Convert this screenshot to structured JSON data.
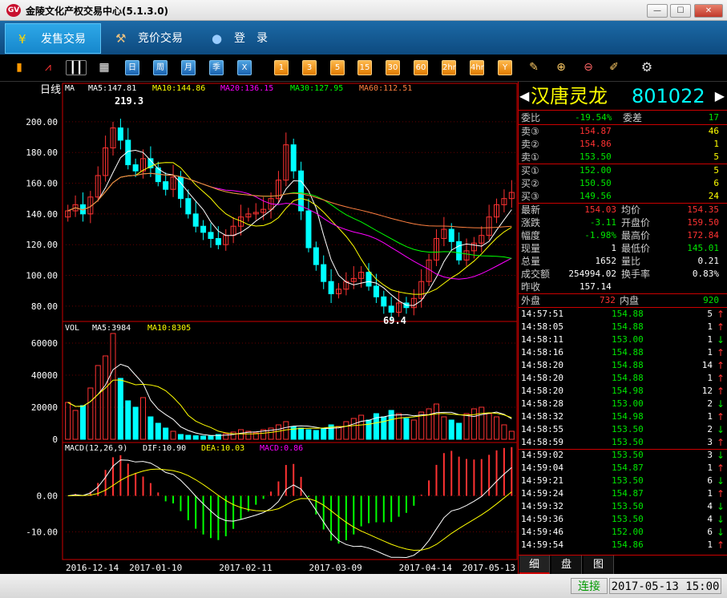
{
  "window": {
    "title": "金陵文化产权交易中心(5.1.3.0)",
    "icon_text": "GV",
    "controls": [
      "minimize-icon",
      "maximize-icon",
      "close-icon"
    ]
  },
  "menu": {
    "tabs": [
      {
        "label": "发售交易",
        "icon": "yen-icon",
        "active": true
      },
      {
        "label": "竞价交易",
        "icon": "gavel-icon",
        "active": false
      },
      {
        "label": "登　录",
        "icon": "user-icon",
        "active": false
      }
    ]
  },
  "toolbar": {
    "icons": [
      "bar-chart-icon",
      "line-chart-icon",
      "candle-chart-icon",
      "calendar-icon"
    ],
    "period_buttons": [
      "日",
      "周",
      "月",
      "季",
      "X"
    ],
    "minute_buttons": [
      "1",
      "3",
      "5",
      "15",
      "30",
      "60",
      "2hr",
      "4hr",
      "Y"
    ],
    "tool_icons": [
      "edit-icon",
      "zoom-in-icon",
      "zoom-out-icon",
      "draw-icon",
      "gear-icon"
    ]
  },
  "chart_data": {
    "type": "candlestick",
    "period_label": "日线",
    "series_label": "MA",
    "ma": {
      "MA5": "147.81",
      "MA10": "144.86",
      "MA20": "136.15",
      "MA30": "127.95",
      "MA60": "112.51"
    },
    "colors": {
      "MA5": "#ffffff",
      "MA10": "#ffff00",
      "MA20": "#ff00ff",
      "MA30": "#00ff00",
      "MA60": "#ff8040",
      "up": "#ff3232",
      "down": "#00ffff"
    },
    "price_ticks": [
      "200.00",
      "180.00",
      "160.00",
      "140.00",
      "120.00",
      "100.00",
      "80.00"
    ],
    "ylim": [
      70,
      225
    ],
    "high_mark": "219.3",
    "low_mark": "69.4",
    "close": [
      142,
      146,
      140,
      151,
      165,
      183,
      196,
      188,
      172,
      168,
      176,
      170,
      161,
      156,
      164,
      150,
      140,
      132,
      128,
      124,
      120,
      126,
      132,
      138,
      140,
      141,
      143,
      150,
      162,
      185,
      168,
      142,
      118,
      107,
      96,
      88,
      91,
      96,
      98,
      102,
      93,
      86,
      80,
      76,
      82,
      79,
      85,
      96,
      110,
      124,
      130,
      122,
      110,
      116,
      121,
      126,
      138,
      146,
      150,
      154
    ],
    "volume": {
      "label": "VOL",
      "MA5": "3984",
      "MA10": "8305",
      "ticks": [
        "60000",
        "40000",
        "20000",
        "0"
      ],
      "ylim": [
        0,
        70000
      ],
      "values": [
        23000,
        18000,
        21000,
        32000,
        46000,
        52000,
        66000,
        38000,
        24000,
        20000,
        26000,
        14000,
        10000,
        7000,
        5000,
        3000,
        2500,
        2200,
        2000,
        2000,
        3000,
        3500,
        4500,
        6000,
        5000,
        4000,
        6000,
        7000,
        9000,
        11000,
        8000,
        7000,
        6000,
        5500,
        7000,
        9000,
        8000,
        11000,
        13000,
        15000,
        12000,
        16000,
        14000,
        18000,
        16000,
        13000,
        12000,
        17000,
        19000,
        22000,
        14000,
        12000,
        10000,
        16000,
        19000,
        20000,
        16000,
        14000,
        9000,
        5000
      ]
    },
    "macd": {
      "label": "MACD(12,26,9)",
      "DIF": "10.90",
      "DEA": "10.03",
      "MACD": "0.86",
      "ticks": [
        "0.00",
        "-10.00"
      ],
      "ylim": [
        -17,
        13
      ]
    },
    "x_dates": [
      "2016-12-14",
      "2017-01-10",
      "2017-02-11",
      "2017-03-09",
      "2017-04-14",
      "2017-05-13"
    ]
  },
  "stock": {
    "name": "汉唐灵龙",
    "code": "801022"
  },
  "quote": {
    "weibi_label": "委比",
    "weibi": "-19.54%",
    "weicha_label": "委差",
    "weicha": "17",
    "asks": [
      {
        "label": "卖③",
        "price": "154.87",
        "vol": "46"
      },
      {
        "label": "卖②",
        "price": "154.86",
        "vol": "1"
      },
      {
        "label": "卖①",
        "price": "153.50",
        "vol": "5"
      }
    ],
    "bids": [
      {
        "label": "买①",
        "price": "152.00",
        "vol": "5"
      },
      {
        "label": "买②",
        "price": "150.50",
        "vol": "6"
      },
      {
        "label": "买③",
        "price": "149.56",
        "vol": "24"
      }
    ],
    "stats": [
      {
        "l1": "最新",
        "v1": "154.03",
        "c1": "red",
        "l2": "均价",
        "v2": "154.35",
        "c2": "red"
      },
      {
        "l1": "涨跌",
        "v1": "-3.11",
        "c1": "green",
        "l2": "开盘价",
        "v2": "159.50",
        "c2": "red"
      },
      {
        "l1": "幅度",
        "v1": "-1.98%",
        "c1": "green",
        "l2": "最高价",
        "v2": "172.84",
        "c2": "red"
      },
      {
        "l1": "现量",
        "v1": "1",
        "c1": "white",
        "l2": "最低价",
        "v2": "145.01",
        "c2": "green"
      },
      {
        "l1": "总量",
        "v1": "1652",
        "c1": "white",
        "l2": "量比",
        "v2": "0.21",
        "c2": "white"
      },
      {
        "l1": "成交额",
        "v1": "254994.02",
        "c1": "white",
        "l2": "换手率",
        "v2": "0.83%",
        "c2": "white"
      }
    ],
    "prev_close_label": "昨收",
    "prev_close": "157.14",
    "outer_label": "外盘",
    "outer": "732",
    "inner_label": "内盘",
    "inner": "920"
  },
  "trades": [
    {
      "t": "14:57:51",
      "p": "154.88",
      "v": "5",
      "d": "up"
    },
    {
      "t": "14:58:05",
      "p": "154.88",
      "v": "1",
      "d": "up"
    },
    {
      "t": "14:58:11",
      "p": "153.00",
      "v": "1",
      "d": "down"
    },
    {
      "t": "14:58:16",
      "p": "154.88",
      "v": "1",
      "d": "up"
    },
    {
      "t": "14:58:20",
      "p": "154.88",
      "v": "14",
      "d": "up"
    },
    {
      "t": "14:58:20",
      "p": "154.88",
      "v": "1",
      "d": "up"
    },
    {
      "t": "14:58:20",
      "p": "154.98",
      "v": "12",
      "d": "up"
    },
    {
      "t": "14:58:28",
      "p": "153.00",
      "v": "2",
      "d": "down"
    },
    {
      "t": "14:58:32",
      "p": "154.98",
      "v": "1",
      "d": "up"
    },
    {
      "t": "14:58:55",
      "p": "153.50",
      "v": "2",
      "d": "down"
    },
    {
      "t": "14:58:59",
      "p": "153.50",
      "v": "3",
      "d": "up"
    },
    {
      "t": "14:59:02",
      "p": "153.50",
      "v": "3",
      "d": "down"
    },
    {
      "t": "14:59:04",
      "p": "154.87",
      "v": "1",
      "d": "up"
    },
    {
      "t": "14:59:21",
      "p": "153.50",
      "v": "6",
      "d": "down"
    },
    {
      "t": "14:59:24",
      "p": "154.87",
      "v": "1",
      "d": "up"
    },
    {
      "t": "14:59:32",
      "p": "153.50",
      "v": "4",
      "d": "down"
    },
    {
      "t": "14:59:36",
      "p": "153.50",
      "v": "4",
      "d": "down"
    },
    {
      "t": "14:59:46",
      "p": "152.00",
      "v": "6",
      "d": "down"
    },
    {
      "t": "14:59:54",
      "p": "154.86",
      "v": "1",
      "d": "up"
    }
  ],
  "bottom_tabs": [
    "细",
    "盘",
    "图"
  ],
  "status": {
    "connection": "连接",
    "datetime": "2017-05-13 15:00"
  }
}
